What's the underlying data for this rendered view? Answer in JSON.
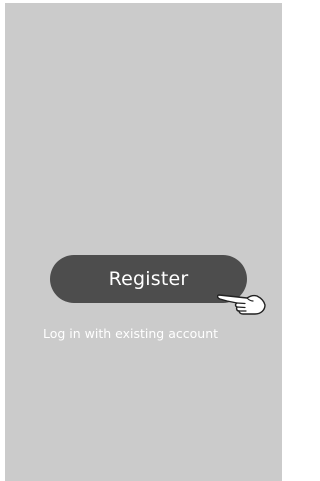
{
  "colors": {
    "screen_background": "#cbcbcb",
    "button_background": "#4d4d4d",
    "text": "#ffffff"
  },
  "register_button": {
    "label": "Register"
  },
  "login_link": {
    "label": "Log in with existing account"
  },
  "icons": {
    "pointer": "tap-hand-icon"
  }
}
